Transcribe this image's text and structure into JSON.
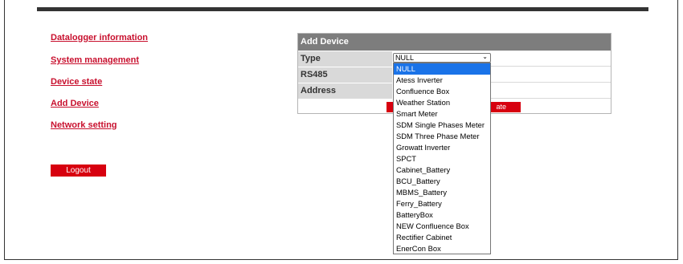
{
  "nav": {
    "items": [
      {
        "label": "Datalogger information"
      },
      {
        "label": "System management"
      },
      {
        "label": "Device state"
      },
      {
        "label": "Add Device"
      },
      {
        "label": "Network setting"
      }
    ],
    "logout_label": "Logout"
  },
  "panel": {
    "title": "Add Device",
    "rows": [
      {
        "label": "Type"
      },
      {
        "label": "RS485"
      },
      {
        "label": "Address"
      }
    ],
    "submit_visible_text": "ate"
  },
  "type_select": {
    "value": "NULL",
    "options": [
      "NULL",
      "Atess Inverter",
      "Confluence Box",
      "Weather Station",
      "Smart Meter",
      "SDM Single Phases Meter",
      "SDM Three Phase Meter",
      "Growatt Inverter",
      "SPCT",
      "Cabinet_Battery",
      "BCU_Battery",
      "MBMS_Battery",
      "Ferry_Battery",
      "BatteryBox",
      "NEW Confluence Box",
      "Rectifier Cabinet",
      "EnerCon Box"
    ],
    "highlighted": "NULL"
  },
  "colors": {
    "link": "#c8102e",
    "button": "#d7000f",
    "header": "#7d7d7d",
    "label_bg": "#d9d9d9",
    "highlight": "#1a73e8"
  }
}
